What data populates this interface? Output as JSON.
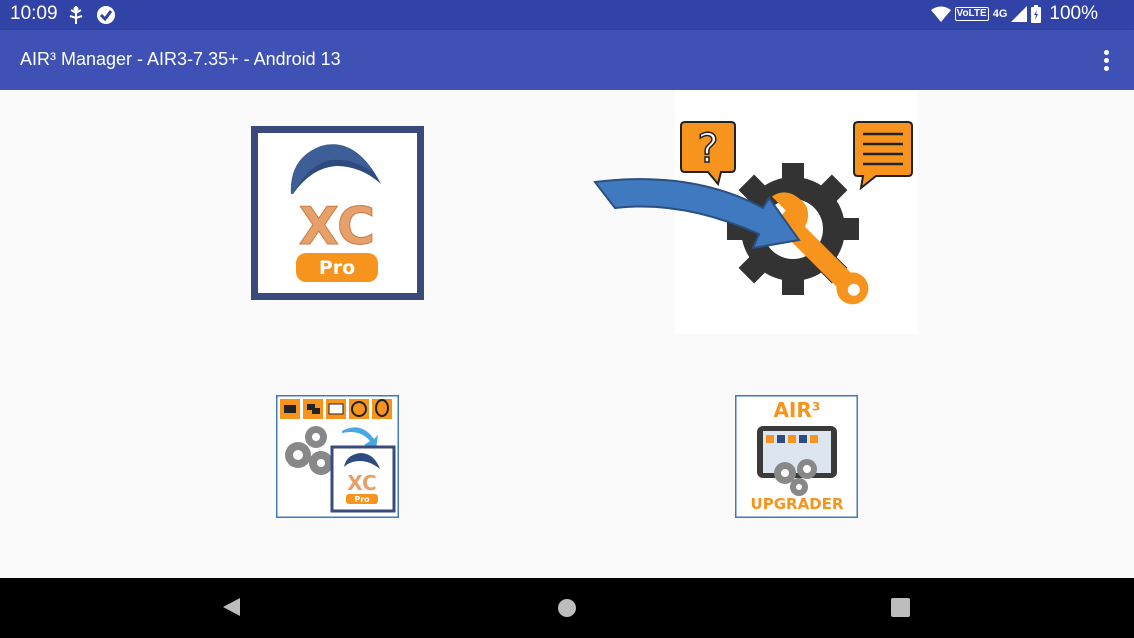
{
  "status_bar": {
    "time": "10:09",
    "left_icons": [
      "usb-debug-icon",
      "check-shield-icon"
    ],
    "network_label": "VoLTE",
    "network_type": "4G",
    "battery": "100%"
  },
  "app_bar": {
    "title": "AIR³ Manager - AIR3-7.35+ - Android 13",
    "overflow_icon": "more-vert-icon"
  },
  "tiles": [
    {
      "name": "xcpro-tile",
      "logo_text": "XC",
      "badge": "Pro"
    },
    {
      "name": "support-tile"
    },
    {
      "name": "xcpro-config-tile",
      "logo_text": "XC",
      "badge": "Pro"
    },
    {
      "name": "upgrader-tile",
      "top_text": "AIR³",
      "bottom_text": "UPGRADER"
    }
  ],
  "nav_bar": {
    "buttons": [
      "back-icon",
      "home-icon",
      "recents-icon"
    ]
  },
  "colors": {
    "status_bar": "#3143a6",
    "app_bar": "#3f51b5",
    "orange": "#f7941d",
    "navy": "#3a4a7a",
    "arrow_blue": "#3f7ac0"
  }
}
